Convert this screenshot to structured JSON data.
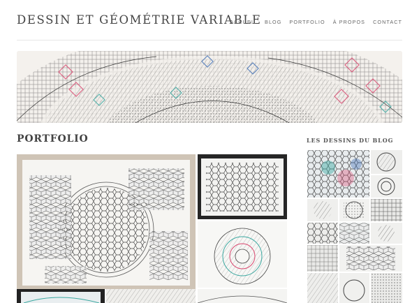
{
  "site": {
    "title": "DESSIN ET GÉOMÉTRIE VARIABLE"
  },
  "nav": {
    "items": [
      "ACCUEIL",
      "BLOG",
      "PORTFOLIO",
      "À PROPOS",
      "CONTACT"
    ]
  },
  "page": {
    "title": "PORTFOLIO"
  },
  "sidebar": {
    "title": "LES DESSINS DU BLOG"
  },
  "colors": {
    "accent_pink": "#d9466e",
    "accent_teal": "#3aa8a0",
    "accent_blue": "#3f6fb5",
    "ink": "#333333"
  }
}
